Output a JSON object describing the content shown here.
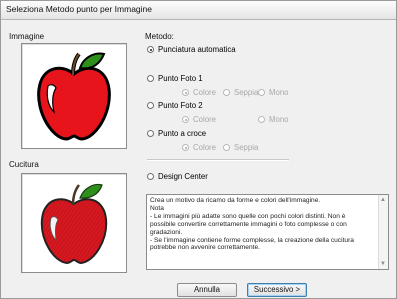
{
  "window": {
    "title": "Seleziona Metodo punto per Immagine"
  },
  "left": {
    "image_label": "Immagine",
    "stitch_label": "Cucitura"
  },
  "method": {
    "label": "Metodo:",
    "options": {
      "auto": "Punciatura automatica",
      "photo1": "Punto Foto 1",
      "photo2": "Punto Foto 2",
      "cross": "Punto a croce",
      "design_center": "Design Center"
    },
    "sub": {
      "colore": "Colore",
      "seppia": "Seppia",
      "mono": "Mono"
    },
    "selected": "auto"
  },
  "description": "Crea un motivo da ricamo da forme e colori dell'immagine.\nNota\n- Le immagini più adatte sono quelle con pochi colori distinti. Non è possibile convertire correttamente immagini o foto complesse o con gradazioni.\n- Se l'immagine contiene forme complesse, la creazione della cucitura potrebbe non avvenire correttamente.",
  "buttons": {
    "cancel": "Annulla",
    "next": "Successivo >"
  },
  "colors": {
    "apple_red": "#e8141c",
    "leaf_green": "#2f8f1c",
    "stem": "#6b4a2a"
  }
}
